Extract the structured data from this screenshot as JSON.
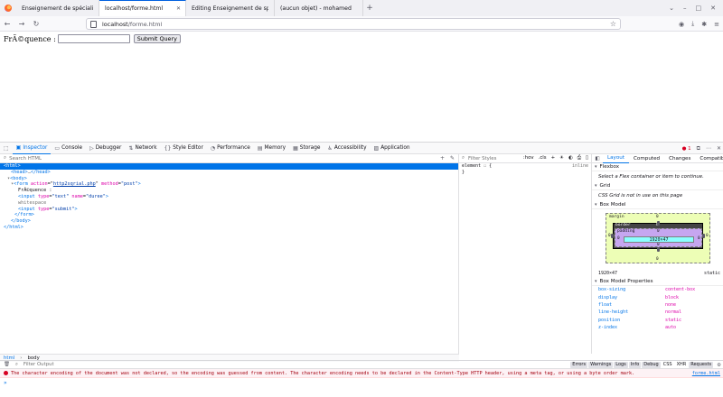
{
  "browser": {
    "tabs": [
      {
        "title": "Enseignement de spécialité",
        "active": false
      },
      {
        "title": "localhost/forme.html",
        "active": true
      },
      {
        "title": "Editing Enseignement de sp",
        "active": false
      },
      {
        "title": "(aucun objet) - mohamed",
        "active": false
      }
    ],
    "url_host": "localhost",
    "url_path": "/forme.html"
  },
  "page": {
    "label": "FrÃ©quence :",
    "input_value": "",
    "submit_label": "Submit Query"
  },
  "devtools": {
    "tools": [
      {
        "label": "Inspector",
        "icon": "inspector-icon"
      },
      {
        "label": "Console",
        "icon": "console-icon"
      },
      {
        "label": "Debugger",
        "icon": "debugger-icon"
      },
      {
        "label": "Network",
        "icon": "network-icon"
      },
      {
        "label": "Style Editor",
        "icon": "style-editor-icon"
      },
      {
        "label": "Performance",
        "icon": "performance-icon"
      },
      {
        "label": "Memory",
        "icon": "memory-icon"
      },
      {
        "label": "Storage",
        "icon": "storage-icon"
      },
      {
        "label": "Accessibility",
        "icon": "accessibility-icon"
      },
      {
        "label": "Application",
        "icon": "application-icon"
      }
    ],
    "error_count": "1",
    "search_placeholder": "Search HTML",
    "markup": {
      "html_open": "<html>",
      "head": "<head>",
      "head_close": "</head>",
      "body_open": "<body>",
      "form_tag": "<form",
      "form_action_attr": "action",
      "form_action_val": "http2sqrial.php",
      "form_method_attr": "method",
      "form_method_val": "\"post\"",
      "form_close_bracket": ">",
      "text_node": "FrÃ©quence :",
      "input1_tag": "<input",
      "input1_type_attr": "type",
      "input1_type_val": "\"text\"",
      "input1_name_attr": "name",
      "input1_name_val": "\"duree\"",
      "input1_end": ">",
      "whitespace": "whitespace",
      "input2_tag": "<input",
      "input2_type_attr": "type",
      "input2_type_val": "\"submit\"",
      "input2_end": ">",
      "form_close": "</form>",
      "body_close": "</body>",
      "html_close": "</html>"
    },
    "breadcrumbs": [
      "html",
      "body"
    ],
    "rules": {
      "filter_placeholder": "Filter Styles",
      "hov": ":hov",
      "cls": ".cls",
      "element_selector": "element",
      "open_brace": "{",
      "close_brace": "}",
      "inline": "inline"
    },
    "layout": {
      "tabs": [
        "Layout",
        "Computed",
        "Changes",
        "Compatibility"
      ],
      "flexbox_title": "Flexbox",
      "flexbox_msg": "Select a Flex container or item to continue.",
      "grid_title": "Grid",
      "grid_msg": "CSS Grid is not in use on this page",
      "boxmodel_title": "Box Model",
      "margin_label": "margin",
      "border_label": "border",
      "padding_label": "padding",
      "content_size": "1920×47",
      "zero": "0",
      "dimensions": "1920×47",
      "position": "static",
      "props_title": "Box Model Properties",
      "props": [
        {
          "name": "box-sizing",
          "value": "content-box"
        },
        {
          "name": "display",
          "value": "block"
        },
        {
          "name": "float",
          "value": "none"
        },
        {
          "name": "line-height",
          "value": "normal"
        },
        {
          "name": "position",
          "value": "static"
        },
        {
          "name": "z-index",
          "value": "auto"
        }
      ]
    },
    "console": {
      "filter_placeholder": "Filter Output",
      "filters": [
        "Errors",
        "Warnings",
        "Logs",
        "Info",
        "Debug",
        "CSS",
        "XHR",
        "Requests"
      ],
      "error_message": "The character encoding of the document was not declared, so the encoding was guessed from content. The character encoding needs to be declared in the Content-Type HTTP header, using a meta tag, or using a byte order mark.",
      "error_source": "forme.html",
      "prompt": "»"
    }
  }
}
